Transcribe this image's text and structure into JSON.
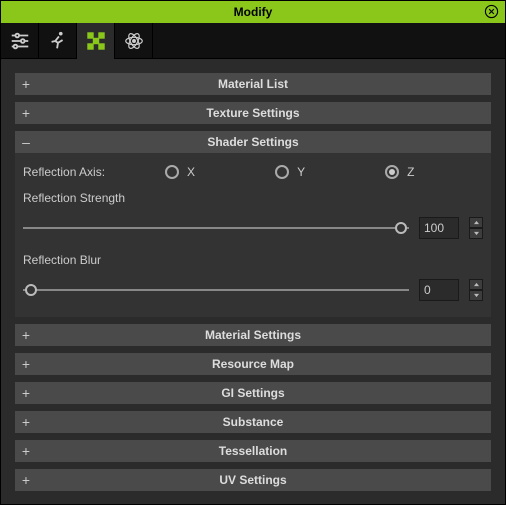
{
  "window": {
    "title": "Modify"
  },
  "tabs": {
    "items": [
      {
        "name": "sliders-tab",
        "icon": "sliders-icon"
      },
      {
        "name": "runner-tab",
        "icon": "runner-icon"
      },
      {
        "name": "checker-tab",
        "icon": "checker-icon",
        "active": true
      },
      {
        "name": "atom-tab",
        "icon": "atom-icon"
      }
    ]
  },
  "sections": {
    "material_list": {
      "label": "Material List",
      "expanded": false
    },
    "texture_settings": {
      "label": "Texture Settings",
      "expanded": false
    },
    "shader_settings": {
      "label": "Shader Settings",
      "expanded": true,
      "reflection_axis": {
        "label": "Reflection Axis:",
        "options": [
          {
            "label": "X",
            "value": "X",
            "selected": false
          },
          {
            "label": "Y",
            "value": "Y",
            "selected": false
          },
          {
            "label": "Z",
            "value": "Z",
            "selected": true
          }
        ]
      },
      "reflection_strength": {
        "label": "Reflection Strength",
        "value": 100,
        "min": 0,
        "max": 100
      },
      "reflection_blur": {
        "label": "Reflection Blur",
        "value": 0,
        "min": 0,
        "max": 100
      }
    },
    "material_settings": {
      "label": "Material Settings",
      "expanded": false
    },
    "resource_map": {
      "label": "Resource Map",
      "expanded": false
    },
    "gi_settings": {
      "label": "GI Settings",
      "expanded": false
    },
    "substance": {
      "label": "Substance",
      "expanded": false
    },
    "tessellation": {
      "label": "Tessellation",
      "expanded": false
    },
    "uv_settings": {
      "label": "UV Settings",
      "expanded": false
    }
  },
  "colors": {
    "accent": "#8bc71b"
  }
}
